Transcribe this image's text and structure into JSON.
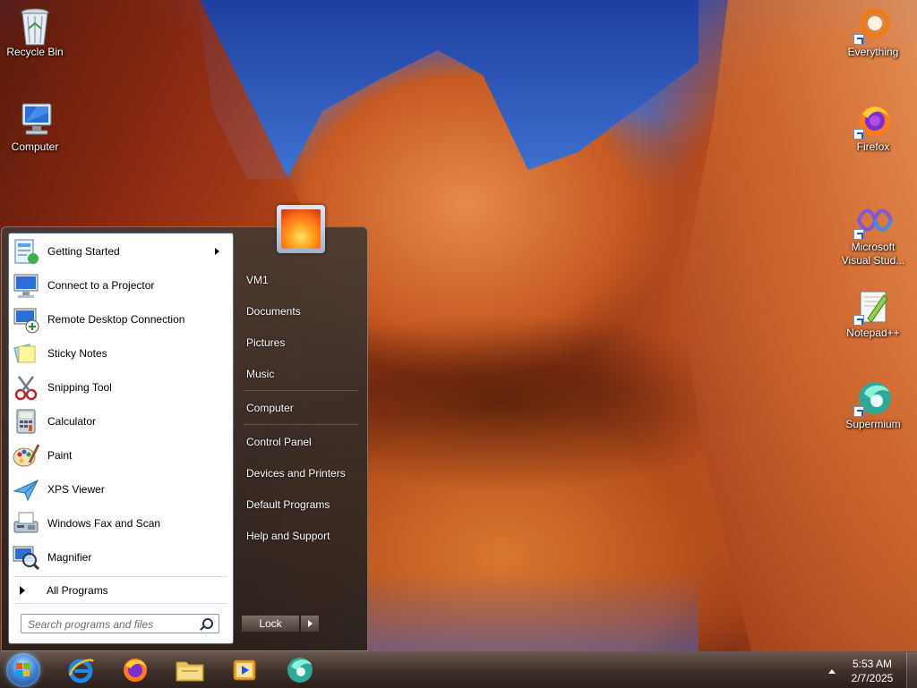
{
  "desktop": {
    "icons": [
      {
        "label": "Recycle Bin",
        "icon": "recycle-bin-icon"
      },
      {
        "label": "Computer",
        "icon": "computer-icon"
      },
      {
        "label": "Everything",
        "icon": "everything-icon",
        "shortcut": true
      },
      {
        "label": "Firefox",
        "icon": "firefox-icon",
        "shortcut": true
      },
      {
        "label": "Microsoft Visual Stud...",
        "icon": "visual-studio-icon",
        "shortcut": true
      },
      {
        "label": "Notepad++",
        "icon": "notepad-plus-plus-icon",
        "shortcut": true
      },
      {
        "label": "Supermium",
        "icon": "supermium-icon",
        "shortcut": true
      }
    ]
  },
  "start_menu": {
    "programs": [
      {
        "label": "Getting Started",
        "icon": "getting-started-icon",
        "has_submenu": true
      },
      {
        "label": "Connect to a Projector",
        "icon": "projector-icon"
      },
      {
        "label": "Remote Desktop Connection",
        "icon": "remote-desktop-icon"
      },
      {
        "label": "Sticky Notes",
        "icon": "sticky-notes-icon"
      },
      {
        "label": "Snipping Tool",
        "icon": "snipping-tool-icon"
      },
      {
        "label": "Calculator",
        "icon": "calculator-icon"
      },
      {
        "label": "Paint",
        "icon": "paint-icon"
      },
      {
        "label": "XPS Viewer",
        "icon": "xps-viewer-icon"
      },
      {
        "label": "Windows Fax and Scan",
        "icon": "fax-scan-icon"
      },
      {
        "label": "Magnifier",
        "icon": "magnifier-icon"
      }
    ],
    "all_programs_label": "All Programs",
    "search_placeholder": "Search programs and files",
    "right_items": [
      {
        "label": "VM1"
      },
      {
        "label": "Documents"
      },
      {
        "label": "Pictures"
      },
      {
        "label": "Music"
      },
      {
        "label": "Computer"
      },
      {
        "label": "Control Panel"
      },
      {
        "label": "Devices and Printers"
      },
      {
        "label": "Default Programs"
      },
      {
        "label": "Help and Support"
      }
    ],
    "lock_label": "Lock"
  },
  "taskbar": {
    "pinned": [
      {
        "icon": "internet-explorer-icon"
      },
      {
        "icon": "firefox-icon"
      },
      {
        "icon": "file-explorer-icon"
      },
      {
        "icon": "media-player-icon"
      },
      {
        "icon": "supermium-icon"
      }
    ],
    "clock_time": "5:53 AM",
    "clock_date": "2/7/2025"
  },
  "colors": {
    "accent": "#3f86d6",
    "menu_dark": "#3a2e28",
    "left_pane": "#ffffff"
  }
}
